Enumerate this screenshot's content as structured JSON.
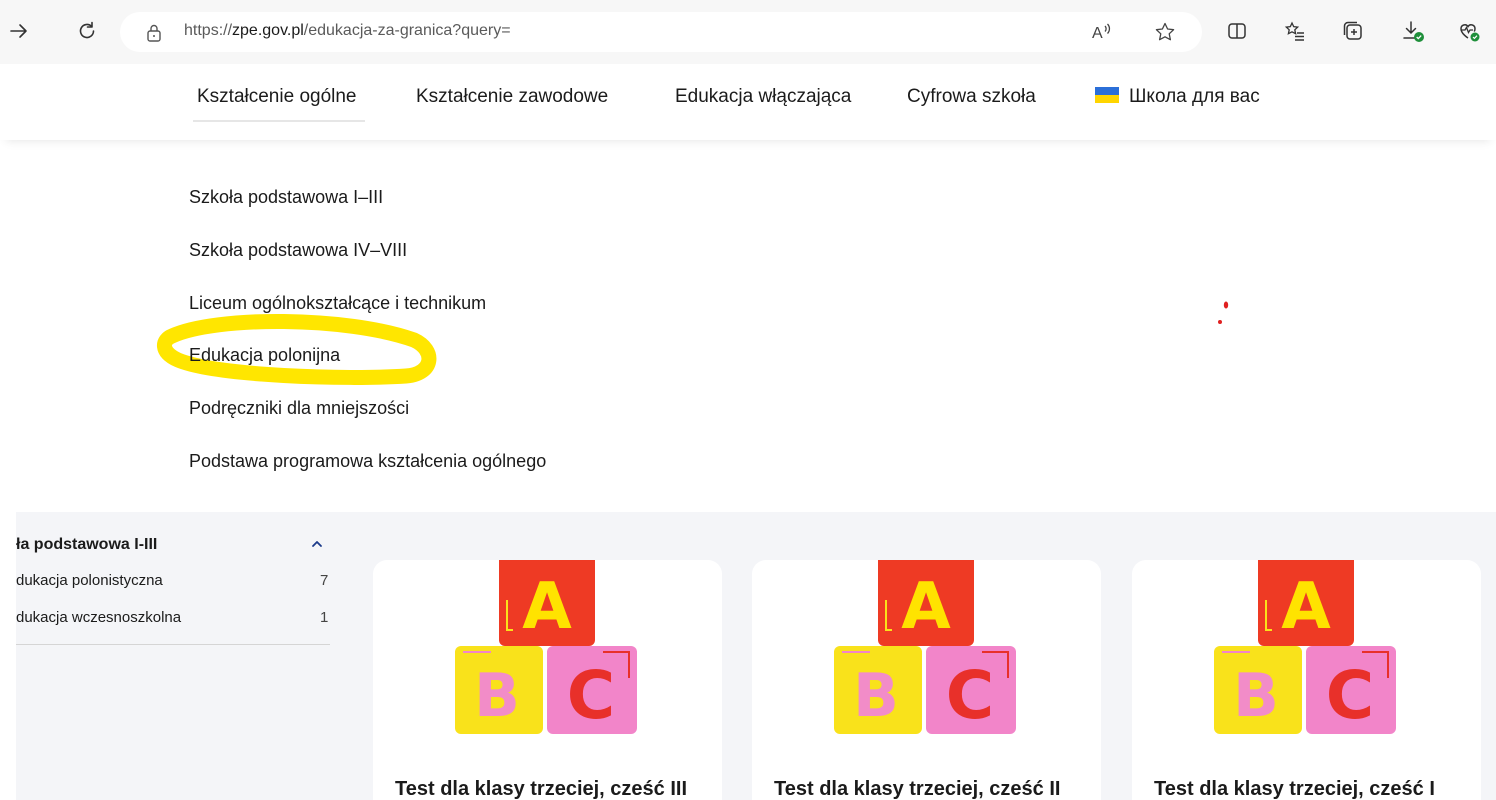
{
  "browser": {
    "url_prefix": "https://",
    "url_domain": "zpe.gov.pl",
    "url_path": "/edukacja-za-granica?query=",
    "read_aloud_label": "A",
    "icons": [
      "forward-icon",
      "refresh-icon",
      "lock-icon",
      "read-aloud-icon",
      "favorite-star-icon",
      "split-screen-icon",
      "favorites-list-icon",
      "collections-icon",
      "downloads-icon",
      "browser-essentials-icon"
    ]
  },
  "nav": {
    "items": [
      {
        "label": "Kształcenie ogólne"
      },
      {
        "label": "Kształcenie zawodowe"
      },
      {
        "label": "Edukacja włączająca"
      },
      {
        "label": "Cyfrowa szkoła"
      },
      {
        "label": "Школа для вас"
      }
    ],
    "flag_colors": {
      "top": "#2b6fd8",
      "bottom": "#ffd500"
    }
  },
  "dropdown": {
    "links": [
      {
        "label": "Szkoła podstawowa I–III"
      },
      {
        "label": "Szkoła podstawowa IV–VIII"
      },
      {
        "label": "Liceum ogólnokształcące i technikum"
      },
      {
        "label": "Edukacja polonijna"
      },
      {
        "label": "Podręczniki dla mniejszości"
      },
      {
        "label": "Podstawa programowa kształcenia ogólnego"
      }
    ],
    "highlight_color": "#ffe600"
  },
  "sidebar": {
    "title": "ła podstawowa I-III",
    "items": [
      {
        "label": "dukacja polonistyczna",
        "count": "7"
      },
      {
        "label": "dukacja wczesnoszkolna",
        "count": "1"
      }
    ]
  },
  "cards": [
    {
      "title": "Test dla klasy trzeciej, cześć III"
    },
    {
      "title": "Test dla klasy trzeciej, cześć II"
    },
    {
      "title": "Test dla klasy trzeciej, cześć I"
    }
  ],
  "colors": {
    "block_red": "#ee3a24",
    "block_yellow": "#f9e21b",
    "block_pink": "#f285c9",
    "letter_yellow": "#ffe300",
    "letter_pink": "#f28cc8",
    "letter_red": "#e8302a"
  }
}
